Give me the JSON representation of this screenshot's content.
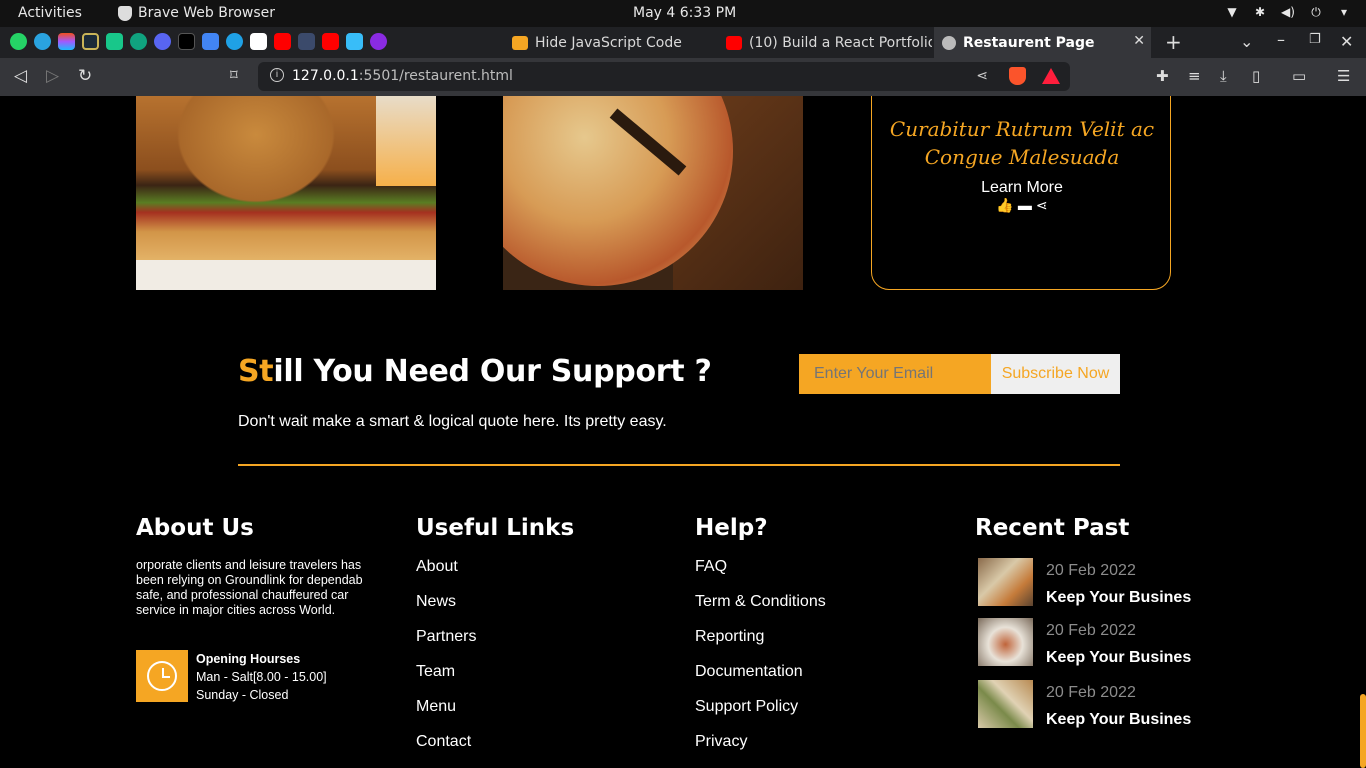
{
  "system": {
    "activities": "Activities",
    "app_name": "Brave Web Browser",
    "clock": "May 4   6:33 PM"
  },
  "tabs": [
    {
      "title": "Hide JavaScript Code",
      "icon": "bookmark-icon"
    },
    {
      "title": "(10) Build a React Portfolio",
      "icon": "youtube-icon"
    },
    {
      "title": "Restaurent Page",
      "icon": "globe-icon",
      "active": true
    }
  ],
  "toolbar": {
    "url_host": "127.0.0.1",
    "url_path": ":5501/restaurent.html"
  },
  "card": {
    "script_text": "Curabitur Rutrum Velit ac Congue Malesuada",
    "learn_more": "Learn More"
  },
  "support": {
    "title_highlight": "St",
    "title_rest": "ill You Need Our Support ?",
    "subtitle": "Don't wait make a smart & logical quote here. Its pretty easy.",
    "email_placeholder": "Enter Your Email",
    "subscribe_label": "Subscribe Now"
  },
  "footer": {
    "about": {
      "heading": "About Us",
      "text": "orporate clients and leisure travelers has been relying on Groundlink for dependab safe, and professional chauffeured car service in major cities across World.",
      "hours_title": "Opening Hourses",
      "hours_line1": "Man - Salt[8.00 - 15.00]",
      "hours_line2": "Sunday - Closed"
    },
    "useful_links": {
      "heading": "Useful Links",
      "items": [
        "About",
        "News",
        "Partners",
        "Team",
        "Menu",
        "Contact"
      ]
    },
    "help": {
      "heading": "Help?",
      "items": [
        "FAQ",
        "Term & Conditions",
        "Reporting",
        "Documentation",
        "Support Policy",
        "Privacy"
      ]
    },
    "recent": {
      "heading": "Recent Past",
      "posts": [
        {
          "date": "20 Feb 2022",
          "title": "Keep Your Busines"
        },
        {
          "date": "20 Feb 2022",
          "title": "Keep Your Busines"
        },
        {
          "date": "20 Feb 2022",
          "title": "Keep Your Busines"
        }
      ]
    }
  },
  "colors": {
    "accent": "#f5a623",
    "background": "#000000"
  }
}
